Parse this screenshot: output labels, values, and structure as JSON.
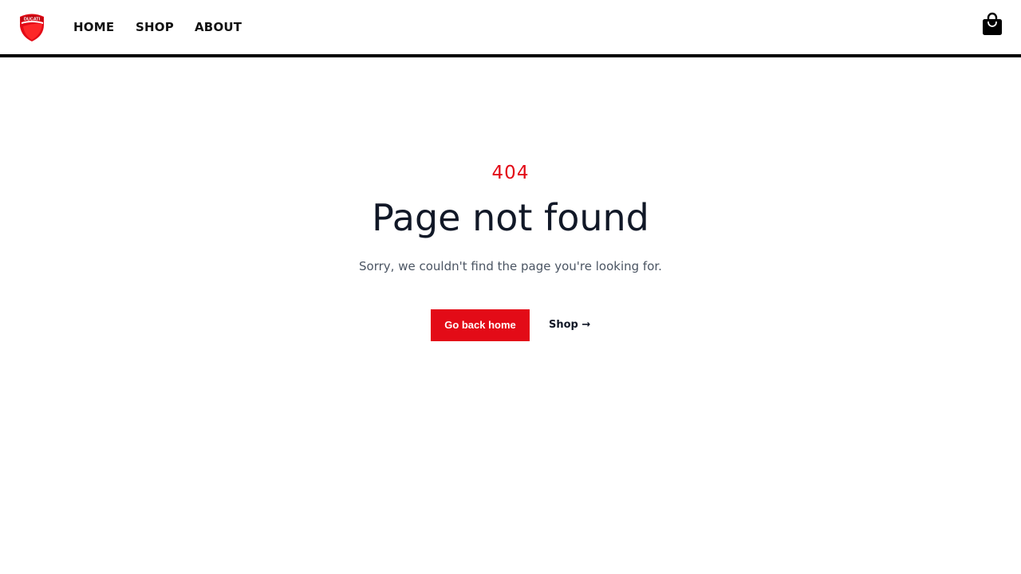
{
  "header": {
    "logo_text": "DUCATI",
    "nav": [
      {
        "label": "HOME"
      },
      {
        "label": "SHOP"
      },
      {
        "label": "ABOUT"
      }
    ],
    "cart_icon": "shopping-bag-icon"
  },
  "main": {
    "code": "404",
    "title": "Page not found",
    "subtitle": "Sorry, we couldn't find the page you're looking for.",
    "primary_button": "Go back home",
    "secondary_link": "Shop →"
  },
  "colors": {
    "accent": "#e30b17",
    "text_dark": "#111827",
    "text_muted": "#4b5563",
    "header_border": "#000000"
  }
}
